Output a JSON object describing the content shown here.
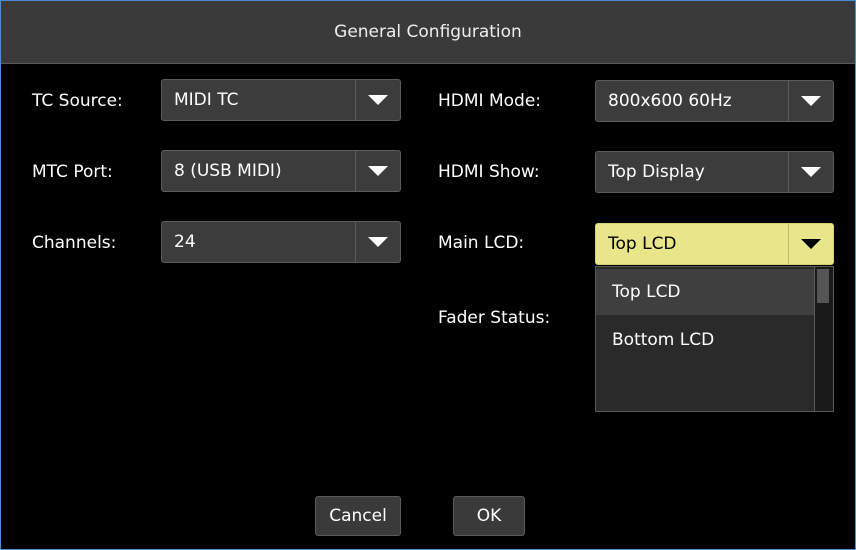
{
  "dialog": {
    "title": "General Configuration"
  },
  "fields": {
    "tc_source": {
      "label": "TC Source:",
      "value": "MIDI TC"
    },
    "mtc_port": {
      "label": "MTC Port:",
      "value": "8 (USB MIDI)"
    },
    "channels": {
      "label": "Channels:",
      "value": "24"
    },
    "hdmi_mode": {
      "label": "HDMI Mode:",
      "value": "800x600 60Hz"
    },
    "hdmi_show": {
      "label": "HDMI Show:",
      "value": "Top Display"
    },
    "main_lcd": {
      "label": "Main LCD:",
      "value": "Top LCD"
    },
    "fader_status": {
      "label": "Fader Status:"
    }
  },
  "main_lcd_dropdown": {
    "options": [
      "Top LCD",
      "Bottom LCD"
    ],
    "highlighted": "Top LCD"
  },
  "buttons": {
    "cancel": "Cancel",
    "ok": "OK"
  },
  "colors": {
    "active_combo": "#e8e58a",
    "window_border": "#4a8fd6",
    "background": "#000000"
  },
  "icons": {
    "dropdown_arrow": "chevron-down-icon"
  }
}
